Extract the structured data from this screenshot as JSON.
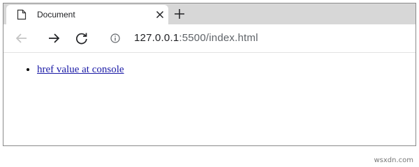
{
  "browser": {
    "tab": {
      "title": "Document",
      "icon": "document-icon",
      "close_icon": "close-icon"
    },
    "new_tab_icon": "plus-icon",
    "toolbar": {
      "back_icon": "arrow-left-icon",
      "forward_icon": "arrow-right-icon",
      "reload_icon": "reload-icon",
      "info_icon": "info-icon",
      "url_host": "127.0.0.1",
      "url_rest": ":5500/index.html"
    }
  },
  "page": {
    "list": [
      {
        "link_text": "href value at console"
      }
    ]
  },
  "watermark": "wsxdn.com"
}
